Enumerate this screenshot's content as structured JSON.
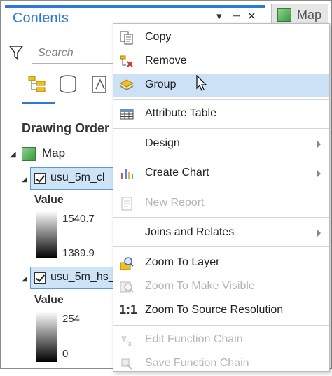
{
  "pane": {
    "title": "Contents",
    "controls": {
      "menu": "▾",
      "pin": "⊣",
      "close": "✕"
    },
    "search_placeholder": "Search",
    "section_header": "Drawing Order"
  },
  "map_tab": {
    "label": "Map"
  },
  "tree": {
    "map_label": "Map",
    "layers": [
      {
        "name": "usu_5m_cl",
        "value_label": "Value",
        "max": "1540.7",
        "min": "1389.9"
      },
      {
        "name": "usu_5m_hs_",
        "value_label": "Value",
        "max": "254",
        "min": "0"
      }
    ]
  },
  "context_menu": {
    "items": [
      {
        "label": "Copy",
        "icon": "copy-icon"
      },
      {
        "label": "Remove",
        "icon": "remove-icon"
      },
      {
        "label": "Group",
        "icon": "group-icon",
        "highlighted": true
      },
      {
        "label": "Attribute Table",
        "icon": "attribute-table-icon"
      },
      {
        "label": "Design",
        "submenu": true
      },
      {
        "label": "Create Chart",
        "icon": "chart-icon",
        "submenu": true
      },
      {
        "label": "New Report",
        "icon": "report-icon",
        "disabled": true
      },
      {
        "label": "Joins and Relates",
        "submenu": true
      },
      {
        "label": "Zoom To Layer",
        "icon": "zoom-layer-icon"
      },
      {
        "label": "Zoom To Make Visible",
        "icon": "zoom-visible-icon",
        "disabled": true
      },
      {
        "label": "Zoom To Source Resolution",
        "icon": "one-to-one-icon",
        "icon_text": "1:1"
      },
      {
        "label": "Edit Function Chain",
        "icon": "function-chain-icon",
        "disabled": true
      },
      {
        "label": "Save Function Chain",
        "icon": "save-chain-icon",
        "disabled": true
      }
    ]
  },
  "colors": {
    "accent": "#2b7bd6",
    "highlight": "#cce1f5",
    "selection_border": "#5d97d8"
  }
}
